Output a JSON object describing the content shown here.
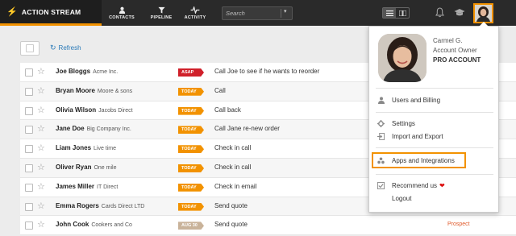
{
  "topbar": {
    "brand": "ACTION STREAM",
    "nav": [
      {
        "label": "CONTACTS",
        "icon": "person-icon"
      },
      {
        "label": "PIPELINE",
        "icon": "funnel-icon"
      },
      {
        "label": "ACTIVITY",
        "icon": "pulse-icon"
      }
    ],
    "search_placeholder": "Search",
    "accent": "#f29200"
  },
  "toolbar": {
    "refresh_label": "Refresh"
  },
  "rows": [
    {
      "name": "Joe Bloggs",
      "company": "Acme Inc.",
      "badge": "ASAP",
      "badge_color": "#d0202a",
      "task": "Call Joe to see if he wants to reorder",
      "stage": ""
    },
    {
      "name": "Bryan Moore",
      "company": "Moore & sons",
      "badge": "TODAY",
      "badge_color": "#f29200",
      "task": "Call",
      "stage": ""
    },
    {
      "name": "Olivia Wilson",
      "company": "Jacobs Direct",
      "badge": "TODAY",
      "badge_color": "#f29200",
      "task": "Call back",
      "stage": ""
    },
    {
      "name": "Jane Doe",
      "company": "Big Company Inc.",
      "badge": "TODAY",
      "badge_color": "#f29200",
      "task": "Call Jane re-new order",
      "stage": ""
    },
    {
      "name": "Liam Jones",
      "company": "Live time",
      "badge": "TODAY",
      "badge_color": "#f29200",
      "task": "Check in call",
      "stage": ""
    },
    {
      "name": "Oliver Ryan",
      "company": "One mile",
      "badge": "TODAY",
      "badge_color": "#f29200",
      "task": "Check in call",
      "stage": ""
    },
    {
      "name": "James Miller",
      "company": "IT Direct",
      "badge": "TODAY",
      "badge_color": "#f29200",
      "task": "Check in email",
      "stage": ""
    },
    {
      "name": "Emma Rogers",
      "company": "Cards Direct LTD",
      "badge": "TODAY",
      "badge_color": "#f29200",
      "task": "Send quote",
      "stage": ""
    },
    {
      "name": "John Cook",
      "company": "Cookers and Co",
      "badge": "AUG 30",
      "badge_color": "#c9b39a",
      "task": "Send quote",
      "stage": "Prospect"
    }
  ],
  "account_menu": {
    "name": "Carmel G.",
    "role": "Account Owner",
    "plan": "PRO ACCOUNT",
    "items": {
      "users_billing": "Users and Billing",
      "settings": "Settings",
      "import_export": "Import and Export",
      "apps": "Apps and Integrations",
      "recommend": "Recommend us",
      "logout": "Logout"
    }
  }
}
